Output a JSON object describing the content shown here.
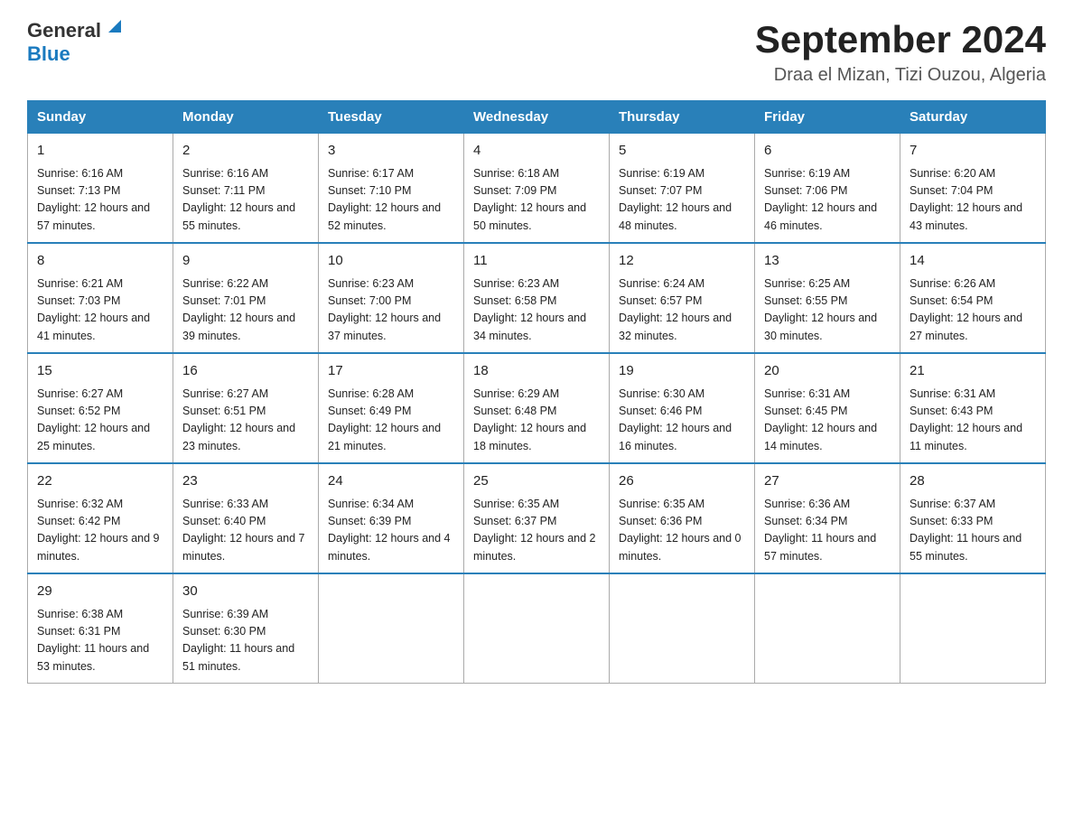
{
  "header": {
    "logo_general": "General",
    "logo_blue": "Blue",
    "title": "September 2024",
    "subtitle": "Draa el Mizan, Tizi Ouzou, Algeria"
  },
  "weekdays": [
    "Sunday",
    "Monday",
    "Tuesday",
    "Wednesday",
    "Thursday",
    "Friday",
    "Saturday"
  ],
  "weeks": [
    [
      {
        "day": "1",
        "sunrise": "Sunrise: 6:16 AM",
        "sunset": "Sunset: 7:13 PM",
        "daylight": "Daylight: 12 hours and 57 minutes."
      },
      {
        "day": "2",
        "sunrise": "Sunrise: 6:16 AM",
        "sunset": "Sunset: 7:11 PM",
        "daylight": "Daylight: 12 hours and 55 minutes."
      },
      {
        "day": "3",
        "sunrise": "Sunrise: 6:17 AM",
        "sunset": "Sunset: 7:10 PM",
        "daylight": "Daylight: 12 hours and 52 minutes."
      },
      {
        "day": "4",
        "sunrise": "Sunrise: 6:18 AM",
        "sunset": "Sunset: 7:09 PM",
        "daylight": "Daylight: 12 hours and 50 minutes."
      },
      {
        "day": "5",
        "sunrise": "Sunrise: 6:19 AM",
        "sunset": "Sunset: 7:07 PM",
        "daylight": "Daylight: 12 hours and 48 minutes."
      },
      {
        "day": "6",
        "sunrise": "Sunrise: 6:19 AM",
        "sunset": "Sunset: 7:06 PM",
        "daylight": "Daylight: 12 hours and 46 minutes."
      },
      {
        "day": "7",
        "sunrise": "Sunrise: 6:20 AM",
        "sunset": "Sunset: 7:04 PM",
        "daylight": "Daylight: 12 hours and 43 minutes."
      }
    ],
    [
      {
        "day": "8",
        "sunrise": "Sunrise: 6:21 AM",
        "sunset": "Sunset: 7:03 PM",
        "daylight": "Daylight: 12 hours and 41 minutes."
      },
      {
        "day": "9",
        "sunrise": "Sunrise: 6:22 AM",
        "sunset": "Sunset: 7:01 PM",
        "daylight": "Daylight: 12 hours and 39 minutes."
      },
      {
        "day": "10",
        "sunrise": "Sunrise: 6:23 AM",
        "sunset": "Sunset: 7:00 PM",
        "daylight": "Daylight: 12 hours and 37 minutes."
      },
      {
        "day": "11",
        "sunrise": "Sunrise: 6:23 AM",
        "sunset": "Sunset: 6:58 PM",
        "daylight": "Daylight: 12 hours and 34 minutes."
      },
      {
        "day": "12",
        "sunrise": "Sunrise: 6:24 AM",
        "sunset": "Sunset: 6:57 PM",
        "daylight": "Daylight: 12 hours and 32 minutes."
      },
      {
        "day": "13",
        "sunrise": "Sunrise: 6:25 AM",
        "sunset": "Sunset: 6:55 PM",
        "daylight": "Daylight: 12 hours and 30 minutes."
      },
      {
        "day": "14",
        "sunrise": "Sunrise: 6:26 AM",
        "sunset": "Sunset: 6:54 PM",
        "daylight": "Daylight: 12 hours and 27 minutes."
      }
    ],
    [
      {
        "day": "15",
        "sunrise": "Sunrise: 6:27 AM",
        "sunset": "Sunset: 6:52 PM",
        "daylight": "Daylight: 12 hours and 25 minutes."
      },
      {
        "day": "16",
        "sunrise": "Sunrise: 6:27 AM",
        "sunset": "Sunset: 6:51 PM",
        "daylight": "Daylight: 12 hours and 23 minutes."
      },
      {
        "day": "17",
        "sunrise": "Sunrise: 6:28 AM",
        "sunset": "Sunset: 6:49 PM",
        "daylight": "Daylight: 12 hours and 21 minutes."
      },
      {
        "day": "18",
        "sunrise": "Sunrise: 6:29 AM",
        "sunset": "Sunset: 6:48 PM",
        "daylight": "Daylight: 12 hours and 18 minutes."
      },
      {
        "day": "19",
        "sunrise": "Sunrise: 6:30 AM",
        "sunset": "Sunset: 6:46 PM",
        "daylight": "Daylight: 12 hours and 16 minutes."
      },
      {
        "day": "20",
        "sunrise": "Sunrise: 6:31 AM",
        "sunset": "Sunset: 6:45 PM",
        "daylight": "Daylight: 12 hours and 14 minutes."
      },
      {
        "day": "21",
        "sunrise": "Sunrise: 6:31 AM",
        "sunset": "Sunset: 6:43 PM",
        "daylight": "Daylight: 12 hours and 11 minutes."
      }
    ],
    [
      {
        "day": "22",
        "sunrise": "Sunrise: 6:32 AM",
        "sunset": "Sunset: 6:42 PM",
        "daylight": "Daylight: 12 hours and 9 minutes."
      },
      {
        "day": "23",
        "sunrise": "Sunrise: 6:33 AM",
        "sunset": "Sunset: 6:40 PM",
        "daylight": "Daylight: 12 hours and 7 minutes."
      },
      {
        "day": "24",
        "sunrise": "Sunrise: 6:34 AM",
        "sunset": "Sunset: 6:39 PM",
        "daylight": "Daylight: 12 hours and 4 minutes."
      },
      {
        "day": "25",
        "sunrise": "Sunrise: 6:35 AM",
        "sunset": "Sunset: 6:37 PM",
        "daylight": "Daylight: 12 hours and 2 minutes."
      },
      {
        "day": "26",
        "sunrise": "Sunrise: 6:35 AM",
        "sunset": "Sunset: 6:36 PM",
        "daylight": "Daylight: 12 hours and 0 minutes."
      },
      {
        "day": "27",
        "sunrise": "Sunrise: 6:36 AM",
        "sunset": "Sunset: 6:34 PM",
        "daylight": "Daylight: 11 hours and 57 minutes."
      },
      {
        "day": "28",
        "sunrise": "Sunrise: 6:37 AM",
        "sunset": "Sunset: 6:33 PM",
        "daylight": "Daylight: 11 hours and 55 minutes."
      }
    ],
    [
      {
        "day": "29",
        "sunrise": "Sunrise: 6:38 AM",
        "sunset": "Sunset: 6:31 PM",
        "daylight": "Daylight: 11 hours and 53 minutes."
      },
      {
        "day": "30",
        "sunrise": "Sunrise: 6:39 AM",
        "sunset": "Sunset: 6:30 PM",
        "daylight": "Daylight: 11 hours and 51 minutes."
      },
      null,
      null,
      null,
      null,
      null
    ]
  ]
}
